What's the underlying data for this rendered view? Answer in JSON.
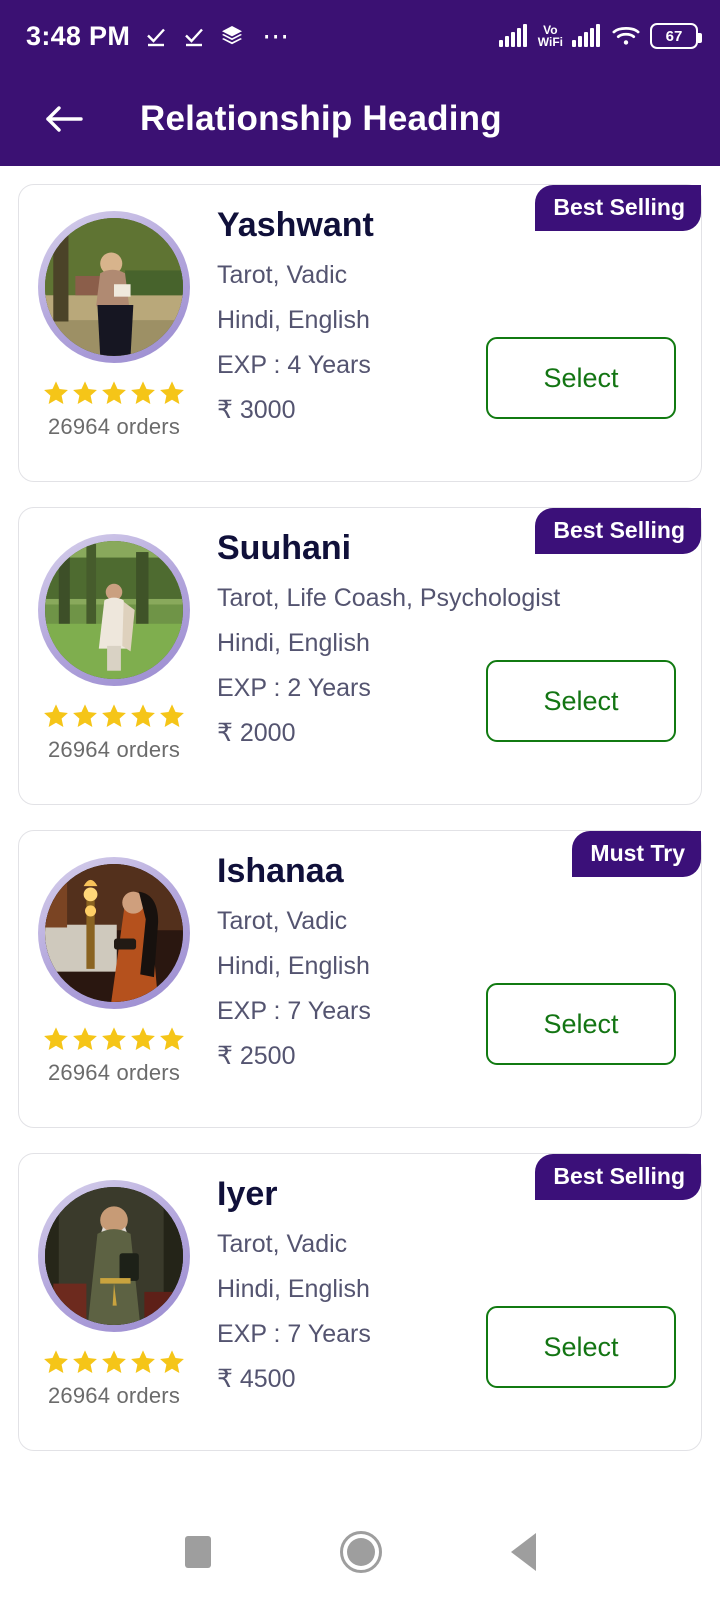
{
  "status_bar": {
    "time": "3:48 PM",
    "left_icons": [
      "download-done-icon",
      "download-done-icon",
      "layers-icon",
      "more-dots-icon"
    ],
    "vo_label": "Vo",
    "wifi_label": "WiFi",
    "battery_level": "67",
    "right_icons": [
      "cellular-signal-icon",
      "vowifi-icon",
      "cellular-signal-icon",
      "wifi-icon",
      "battery-icon"
    ],
    "bg_color": "#3B1173"
  },
  "app_bar": {
    "title": "Relationship Heading",
    "back_icon": "arrow-left-icon",
    "bg_color": "#3B1173",
    "title_color": "#FFFFFF"
  },
  "colors": {
    "badge_bg": "#3B1079",
    "select_border": "#117A11",
    "select_text": "#137513",
    "star": "#F5C518",
    "name_text": "#10103A",
    "meta_text": "#545470",
    "orders_text": "#6B6B6B",
    "avatar_ring": "#A89BD4"
  },
  "select_label": "Select",
  "cards": [
    {
      "badge": "Best Selling",
      "name": "Yashwant",
      "skills": "Tarot, Vadic",
      "languages": "Hindi, English",
      "experience": "EXP : 4 Years",
      "price": "₹ 3000",
      "orders": "26964 orders",
      "rating": 5,
      "avatar": "woman-reading-outdoors"
    },
    {
      "badge": "Best Selling",
      "name": "Suuhani",
      "skills": "Tarot, Life Coash, Psychologist",
      "languages": "Hindi, English",
      "experience": "EXP : 2 Years",
      "price": "₹ 2000",
      "orders": "26964 orders",
      "rating": 5,
      "avatar": "person-in-garden"
    },
    {
      "badge": "Must Try",
      "name": "Ishanaa",
      "skills": "Tarot, Vadic",
      "languages": "Hindi, English",
      "experience": "EXP : 7 Years",
      "price": "₹ 2500",
      "orders": "26964 orders",
      "rating": 5,
      "avatar": "woman-with-candles"
    },
    {
      "badge": "Best Selling",
      "name": "Iyer",
      "skills": "Tarot, Vadic",
      "languages": "Hindi, English",
      "experience": "EXP : 7 Years",
      "price": "₹ 4500",
      "orders": "26964 orders",
      "rating": 5,
      "avatar": "elder-man-robe"
    }
  ],
  "nav_bar": {
    "recents_icon": "square-icon",
    "home_icon": "circle-icon",
    "back_icon": "triangle-left-icon"
  }
}
